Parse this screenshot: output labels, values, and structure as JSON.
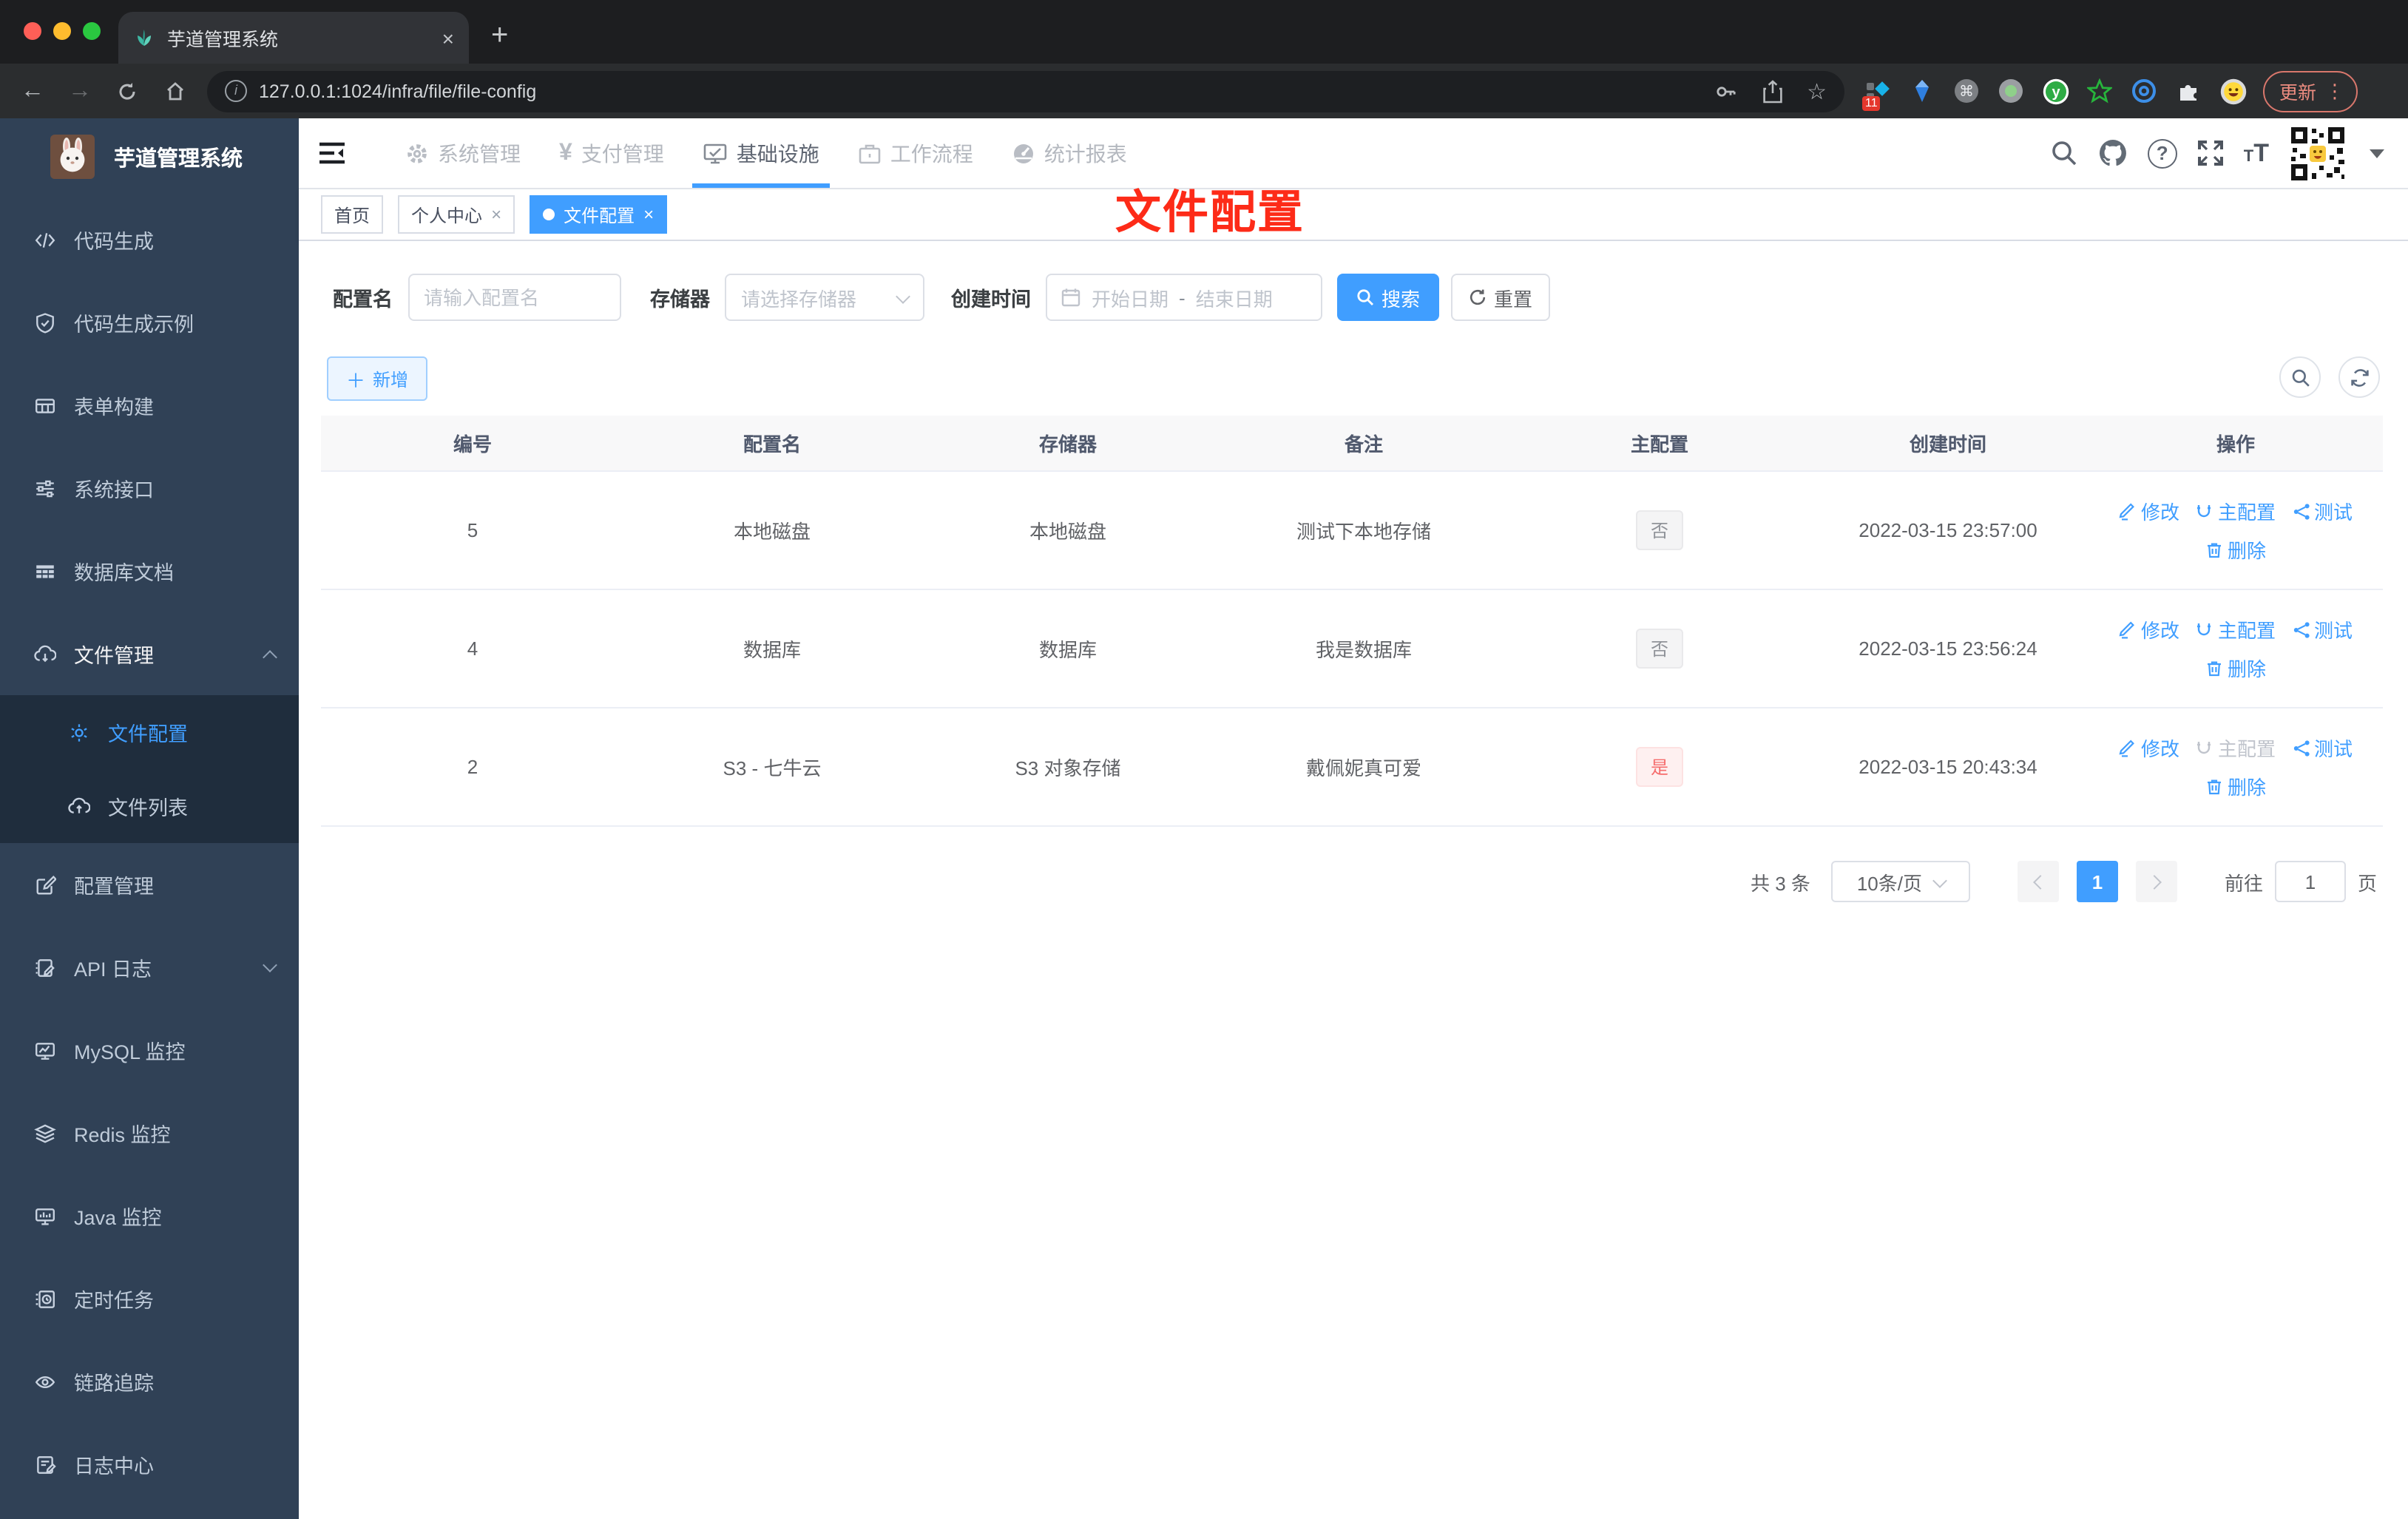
{
  "browser": {
    "tab_title": "芋道管理系统",
    "close_tab": "×",
    "new_tab": "+",
    "url": "127.0.0.1:1024/infra/file/file-config",
    "update_label": "更新",
    "extensions_badge": "11"
  },
  "sidebar": {
    "app_title": "芋道管理系统",
    "items": [
      {
        "label": "代码生成"
      },
      {
        "label": "代码生成示例"
      },
      {
        "label": "表单构建"
      },
      {
        "label": "系统接口"
      },
      {
        "label": "数据库文档"
      },
      {
        "label": "文件管理"
      },
      {
        "label": "文件配置"
      },
      {
        "label": "文件列表"
      },
      {
        "label": "配置管理"
      },
      {
        "label": "API 日志"
      },
      {
        "label": "MySQL 监控"
      },
      {
        "label": "Redis 监控"
      },
      {
        "label": "Java 监控"
      },
      {
        "label": "定时任务"
      },
      {
        "label": "链路追踪"
      },
      {
        "label": "日志中心"
      }
    ]
  },
  "topnav": {
    "items": [
      "系统管理",
      "支付管理",
      "基础设施",
      "工作流程",
      "统计报表"
    ]
  },
  "tags": {
    "home": "首页",
    "profile": "个人中心",
    "file_config": "文件配置"
  },
  "annotation": "文件配置",
  "filter": {
    "config_name_label": "配置名",
    "config_name_placeholder": "请输入配置名",
    "storage_label": "存储器",
    "storage_placeholder": "请选择存储器",
    "create_time_label": "创建时间",
    "start_date_placeholder": "开始日期",
    "range_separator": "-",
    "end_date_placeholder": "结束日期",
    "search_label": "搜索",
    "reset_label": "重置"
  },
  "toolbar": {
    "add_label": "新增"
  },
  "table": {
    "headers": [
      "编号",
      "配置名",
      "存储器",
      "备注",
      "主配置",
      "创建时间",
      "操作"
    ],
    "rows": [
      {
        "id": "5",
        "name": "本地磁盘",
        "storage": "本地磁盘",
        "remark": "测试下本地存储",
        "master": "否",
        "created": "2022-03-15 23:57:00"
      },
      {
        "id": "4",
        "name": "数据库",
        "storage": "数据库",
        "remark": "我是数据库",
        "master": "否",
        "created": "2022-03-15 23:56:24"
      },
      {
        "id": "2",
        "name": "S3 - 七牛云",
        "storage": "S3 对象存储",
        "remark": "戴佩妮真可爱",
        "master": "是",
        "created": "2022-03-15 20:43:34"
      }
    ],
    "actions": {
      "edit": "修改",
      "master": "主配置",
      "test": "测试",
      "delete": "删除"
    }
  },
  "pagination": {
    "total": "共 3 条",
    "page_size": "10条/页",
    "page": "1",
    "goto_label": "前往",
    "goto_value": "1",
    "page_unit": "页"
  },
  "colors": {
    "accent": "#409eff",
    "annotation_red": "#fd2b18",
    "sidebar_bg": "#304156",
    "submenu_bg": "#1f2d3d",
    "danger": "#f56c6c"
  }
}
